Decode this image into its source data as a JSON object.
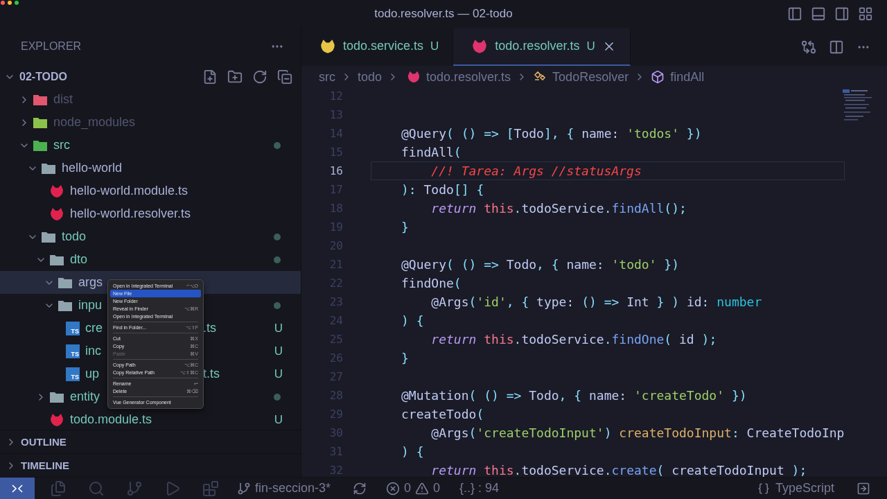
{
  "window": {
    "title": "todo.resolver.ts — 02-todo"
  },
  "explorer": {
    "title": "EXPLORER",
    "root": {
      "label": "02-TODO",
      "expanded": true
    },
    "tree": [
      {
        "label": "dist",
        "kind": "folder",
        "color": "#e2566e",
        "expanded": false,
        "ignored": true,
        "untracked": false,
        "modified": false,
        "selected": false
      },
      {
        "label": "node_modules",
        "kind": "folder",
        "color": "#8bc34a",
        "expanded": false,
        "ignored": true,
        "untracked": false,
        "modified": false,
        "selected": false
      },
      {
        "label": "src",
        "kind": "folder",
        "color": "#4caf50",
        "expanded": true,
        "ignored": false,
        "untracked": true,
        "modified": true,
        "selected": false,
        "children": [
          {
            "label": "hello-world",
            "kind": "folder",
            "color": "#90a4ae",
            "expanded": true,
            "ignored": false,
            "untracked": false,
            "modified": false,
            "selected": false,
            "children": [
              {
                "label": "hello-world.module.ts",
                "kind": "cat",
                "color": "#e0234e",
                "ignored": false,
                "untracked": false,
                "modified": false,
                "selected": false
              },
              {
                "label": "hello-world.resolver.ts",
                "kind": "cat",
                "color": "#e0234e",
                "ignored": false,
                "untracked": false,
                "modified": false,
                "selected": false
              }
            ]
          },
          {
            "label": "todo",
            "kind": "folder",
            "color": "#90a4ae",
            "expanded": true,
            "ignored": false,
            "untracked": true,
            "modified": true,
            "selected": false,
            "children": [
              {
                "label": "dto",
                "kind": "folder",
                "color": "#90a4ae",
                "expanded": true,
                "ignored": false,
                "untracked": true,
                "modified": true,
                "selected": false,
                "children": [
                  {
                    "label": "args",
                    "kind": "folder",
                    "color": "#90a4ae",
                    "expanded": true,
                    "ignored": false,
                    "untracked": false,
                    "modified": false,
                    "selected": true
                  },
                  {
                    "label": "inpu",
                    "kind": "folder",
                    "color": "#90a4ae",
                    "expanded": true,
                    "ignored": false,
                    "untracked": true,
                    "modified": true,
                    "selected": false,
                    "children": [
                      {
                        "label": "cre",
                        "tail": ".ts",
                        "kind": "ts",
                        "icon_label": "TS",
                        "ignored": false,
                        "untracked": true,
                        "badge": "U",
                        "modified": false,
                        "selected": false
                      },
                      {
                        "label": "inc",
                        "kind": "ts",
                        "icon_label": "TS",
                        "ignored": false,
                        "untracked": true,
                        "badge": "U",
                        "modified": false,
                        "selected": false
                      },
                      {
                        "label": "up",
                        "tail": "t.ts",
                        "kind": "ts",
                        "icon_label": "TS",
                        "ignored": false,
                        "untracked": true,
                        "badge": "U",
                        "modified": false,
                        "selected": false
                      }
                    ]
                  }
                ]
              },
              {
                "label": "entity",
                "kind": "folder",
                "color": "#90a4ae",
                "expanded": false,
                "ignored": false,
                "untracked": true,
                "modified": true,
                "selected": false
              },
              {
                "label": "todo.module.ts",
                "kind": "cat",
                "color": "#e0234e",
                "ignored": false,
                "untracked": true,
                "badge": "U",
                "modified": false,
                "selected": false
              }
            ]
          }
        ]
      }
    ]
  },
  "panels": [
    {
      "label": "OUTLINE",
      "expanded": false
    },
    {
      "label": "TIMELINE",
      "expanded": false
    }
  ],
  "tabs": [
    {
      "label": "todo.service.ts",
      "badge": "U",
      "color": "#e8c547",
      "selected": false
    },
    {
      "label": "todo.resolver.ts",
      "badge": "U",
      "color": "#e0346e",
      "selected": true
    }
  ],
  "breadcrumbs": [
    {
      "label": "src",
      "kind": "plain"
    },
    {
      "label": "todo",
      "kind": "plain"
    },
    {
      "label": "todo.resolver.ts",
      "kind": "cat"
    },
    {
      "label": "TodoResolver",
      "kind": "class"
    },
    {
      "label": "findAll",
      "kind": "method"
    }
  ],
  "editor": {
    "lines": [
      {
        "number": "12",
        "current": false
      },
      {
        "number": "13",
        "current": false
      },
      {
        "number": "14",
        "current": false,
        "tokens": [
          {
            "text": "@Query",
            "kind": "plain"
          },
          {
            "text": "( () => [",
            "kind": "punct"
          },
          {
            "text": "Todo",
            "kind": "plain"
          },
          {
            "text": "], { ",
            "kind": "punct"
          },
          {
            "text": "name: ",
            "kind": "plain"
          },
          {
            "text": "'todos'",
            "kind": "string"
          },
          {
            "text": " })",
            "kind": "punct"
          }
        ]
      },
      {
        "number": "15",
        "current": false,
        "tokens": [
          {
            "text": "findAll",
            "kind": "plain"
          },
          {
            "text": "(",
            "kind": "punct"
          }
        ]
      },
      {
        "number": "16",
        "current": true,
        "tokens": [
          {
            "text": "    //! Tarea: Args //statusArgs",
            "kind": "comment"
          }
        ]
      },
      {
        "number": "17",
        "current": false,
        "tokens": [
          {
            "text": "): ",
            "kind": "punct"
          },
          {
            "text": "Todo",
            "kind": "plain"
          },
          {
            "text": "[] {",
            "kind": "punct"
          }
        ]
      },
      {
        "number": "18",
        "current": false,
        "tokens": [
          {
            "text": "    return ",
            "kind": "keyword"
          },
          {
            "text": "this",
            "kind": "this"
          },
          {
            "text": ".",
            "kind": "punct"
          },
          {
            "text": "todoService",
            "kind": "plain"
          },
          {
            "text": ".",
            "kind": "punct"
          },
          {
            "text": "findAll",
            "kind": "func"
          },
          {
            "text": "();",
            "kind": "punct"
          }
        ]
      },
      {
        "number": "19",
        "current": false,
        "tokens": [
          {
            "text": "}",
            "kind": "punct"
          }
        ]
      },
      {
        "number": "20",
        "current": false
      },
      {
        "number": "21",
        "current": false,
        "tokens": [
          {
            "text": "@Query",
            "kind": "plain"
          },
          {
            "text": "( () => ",
            "kind": "punct"
          },
          {
            "text": "Todo",
            "kind": "plain"
          },
          {
            "text": ", { ",
            "kind": "punct"
          },
          {
            "text": "name: ",
            "kind": "plain"
          },
          {
            "text": "'todo'",
            "kind": "string"
          },
          {
            "text": " })",
            "kind": "punct"
          }
        ]
      },
      {
        "number": "22",
        "current": false,
        "tokens": [
          {
            "text": "findOne",
            "kind": "plain"
          },
          {
            "text": "(",
            "kind": "punct"
          }
        ]
      },
      {
        "number": "23",
        "current": false,
        "tokens": [
          {
            "text": "    @Args",
            "kind": "plain"
          },
          {
            "text": "(",
            "kind": "punct"
          },
          {
            "text": "'id'",
            "kind": "string"
          },
          {
            "text": ", { ",
            "kind": "punct"
          },
          {
            "text": "type: ",
            "kind": "plain"
          },
          {
            "text": "() => ",
            "kind": "punct"
          },
          {
            "text": "Int",
            "kind": "plain"
          },
          {
            "text": " } ) ",
            "kind": "punct"
          },
          {
            "text": "id: ",
            "kind": "plain"
          },
          {
            "text": "number",
            "kind": "type"
          }
        ]
      },
      {
        "number": "24",
        "current": false,
        "tokens": [
          {
            "text": ") {",
            "kind": "punct"
          }
        ]
      },
      {
        "number": "25",
        "current": false,
        "tokens": [
          {
            "text": "    return ",
            "kind": "keyword"
          },
          {
            "text": "this",
            "kind": "this"
          },
          {
            "text": ".",
            "kind": "punct"
          },
          {
            "text": "todoService",
            "kind": "plain"
          },
          {
            "text": ".",
            "kind": "punct"
          },
          {
            "text": "findOne",
            "kind": "func"
          },
          {
            "text": "( ",
            "kind": "punct"
          },
          {
            "text": "id",
            "kind": "plain"
          },
          {
            "text": " );",
            "kind": "punct"
          }
        ]
      },
      {
        "number": "26",
        "current": false,
        "tokens": [
          {
            "text": "}",
            "kind": "punct"
          }
        ]
      },
      {
        "number": "27",
        "current": false
      },
      {
        "number": "28",
        "current": false,
        "tokens": [
          {
            "text": "@Mutation",
            "kind": "plain"
          },
          {
            "text": "( () => ",
            "kind": "punct"
          },
          {
            "text": "Todo",
            "kind": "plain"
          },
          {
            "text": ", { ",
            "kind": "punct"
          },
          {
            "text": "name: ",
            "kind": "plain"
          },
          {
            "text": "'createTodo'",
            "kind": "string"
          },
          {
            "text": " })",
            "kind": "punct"
          }
        ]
      },
      {
        "number": "29",
        "current": false,
        "tokens": [
          {
            "text": "createTodo",
            "kind": "plain"
          },
          {
            "text": "(",
            "kind": "punct"
          }
        ]
      },
      {
        "number": "30",
        "current": false,
        "tokens": [
          {
            "text": "    @Args",
            "kind": "plain"
          },
          {
            "text": "(",
            "kind": "punct"
          },
          {
            "text": "'createTodoInput'",
            "kind": "string"
          },
          {
            "text": ") ",
            "kind": "punct"
          },
          {
            "text": "createTodoInput",
            "kind": "param"
          },
          {
            "text": ": ",
            "kind": "punct"
          },
          {
            "text": "CreateTodoInp",
            "kind": "plain"
          }
        ]
      },
      {
        "number": "31",
        "current": false,
        "tokens": [
          {
            "text": ") {",
            "kind": "punct"
          }
        ]
      },
      {
        "number": "32",
        "current": false,
        "tokens": [
          {
            "text": "    return ",
            "kind": "keyword"
          },
          {
            "text": "this",
            "kind": "this"
          },
          {
            "text": ".",
            "kind": "punct"
          },
          {
            "text": "todoService",
            "kind": "plain"
          },
          {
            "text": ".",
            "kind": "punct"
          },
          {
            "text": "create",
            "kind": "func"
          },
          {
            "text": "( ",
            "kind": "punct"
          },
          {
            "text": "createTodoInput",
            "kind": "plain"
          },
          {
            "text": " );",
            "kind": "punct"
          }
        ]
      }
    ]
  },
  "context_menu": {
    "groups": [
      [
        {
          "label": "Open in Integrated Terminal",
          "shortcut": "^⌥O",
          "selected": false,
          "disabled": false
        },
        {
          "label": "New File",
          "selected": true,
          "disabled": false
        },
        {
          "label": "New Folder",
          "selected": false,
          "disabled": false
        },
        {
          "label": "Reveal in Finder",
          "shortcut": "⌥⌘R",
          "selected": false,
          "disabled": false
        },
        {
          "label": "Open in Integrated Terminal",
          "selected": false,
          "disabled": false
        }
      ],
      [
        {
          "label": "Find in Folder...",
          "shortcut": "⌥⇧F",
          "selected": false,
          "disabled": false
        }
      ],
      [
        {
          "label": "Cut",
          "shortcut": "⌘X",
          "selected": false,
          "disabled": false
        },
        {
          "label": "Copy",
          "shortcut": "⌘C",
          "selected": false,
          "disabled": false
        },
        {
          "label": "Paste",
          "shortcut": "⌘V",
          "selected": false,
          "disabled": true
        }
      ],
      [
        {
          "label": "Copy Path",
          "shortcut": "⌥⌘C",
          "selected": false,
          "disabled": false
        },
        {
          "label": "Copy Relative Path",
          "shortcut": "⌥⇧⌘C",
          "selected": false,
          "disabled": false
        }
      ],
      [
        {
          "label": "Rename",
          "shortcut": "↩",
          "selected": false,
          "disabled": false
        },
        {
          "label": "Delete",
          "shortcut": "⌘⌫",
          "selected": false,
          "disabled": false
        }
      ],
      [
        {
          "label": "Vue Generator Component",
          "selected": false,
          "disabled": false
        }
      ]
    ]
  },
  "status_bar": {
    "branch": "fin-seccion-3*",
    "errors": "0",
    "warnings": "0",
    "position": "{..} : 94",
    "language": "TypeScript"
  }
}
